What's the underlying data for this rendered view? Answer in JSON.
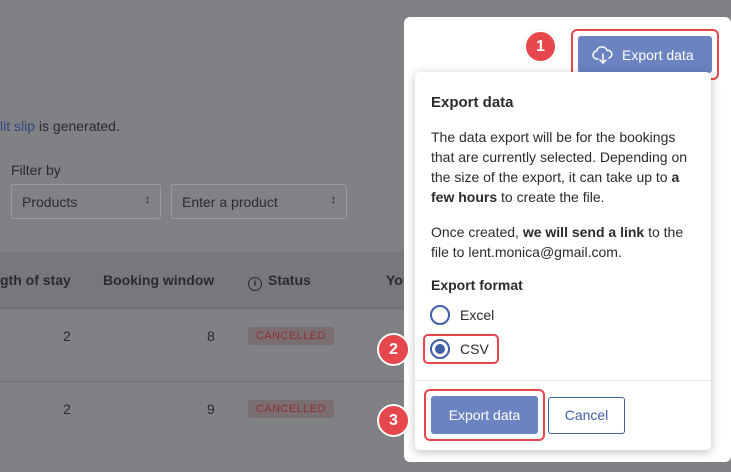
{
  "background": {
    "info_link": "lit slip",
    "info_text": " is generated.",
    "filter_label": "Filter by",
    "product_select_value": "Products",
    "product_input_placeholder": "Enter a product",
    "columns": [
      "gth of stay",
      "Booking window",
      "Status",
      "You"
    ],
    "rows": [
      {
        "length_of_stay": "2",
        "booking_window": "8",
        "status": "CANCELLED"
      },
      {
        "length_of_stay": "2",
        "booking_window": "9",
        "status": "CANCELLED"
      }
    ]
  },
  "top_button": {
    "label": "Export data",
    "icon": "cloud-download-icon"
  },
  "popover": {
    "title": "Export data",
    "p1_a": "The data export will be for the bookings that are currently selected. Depending on the size of the export, it can take up to ",
    "p1_bold": "a few hours",
    "p1_b": " to create the file.",
    "p2_a": "Once created, ",
    "p2_bold": "we will send a link",
    "p2_b": " to the file to lent.monica@gmail.com.",
    "format_label": "Export format",
    "options": [
      {
        "label": "Excel",
        "selected": false
      },
      {
        "label": "CSV",
        "selected": true
      }
    ],
    "export_label": "Export data",
    "cancel_label": "Cancel"
  },
  "steps": [
    "1",
    "2",
    "3"
  ],
  "colors": {
    "accent": "#6b83c0",
    "highlight": "#e5474d",
    "radio": "#3f5fa8"
  }
}
